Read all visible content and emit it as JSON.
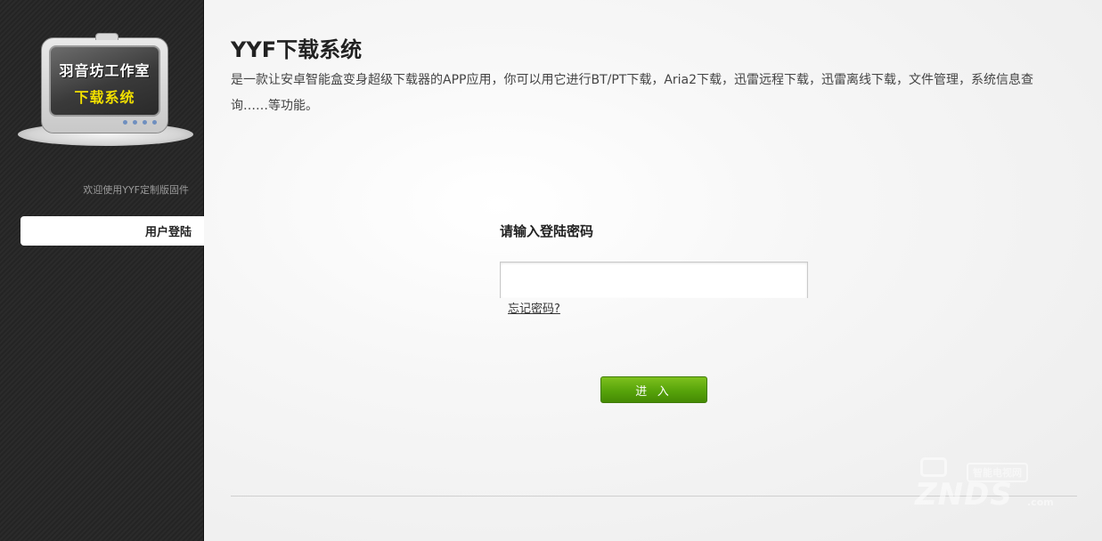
{
  "sidebar": {
    "logo": {
      "line1": "羽音坊工作室",
      "line2": "下载系统"
    },
    "welcome_text": "欢迎使用YYF定制版固件",
    "nav_items": [
      {
        "label": "用户登陆"
      }
    ]
  },
  "main": {
    "title": "YYF下载系统",
    "description": "是一款让安卓智能盒变身超级下载器的APP应用，你可以用它进行BT/PT下载，Aria2下载，迅雷远程下载，迅雷离线下载，文件管理，系统信息查询……等功能。",
    "login": {
      "password_label": "请输入登陆密码",
      "password_value": "",
      "forgot_link": "忘记密码?",
      "submit_label": "进 入"
    }
  },
  "watermark": {
    "badge": "智能电视网",
    "text": "ZNDS",
    "suffix": ".com"
  },
  "colors": {
    "sidebar_bg": "#2b2b2b",
    "button_green": "#57a30a",
    "logo_yellow": "#f2e000"
  }
}
